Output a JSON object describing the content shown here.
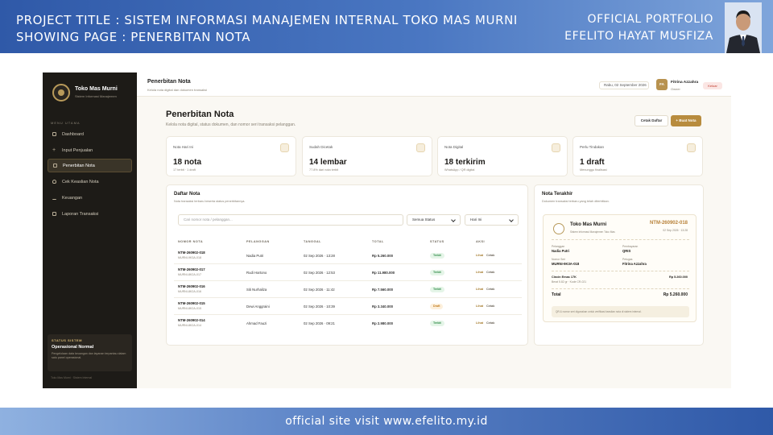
{
  "banner": {
    "line1": "PROJECT TITLE  : SISTEM INFORMASI MANAJEMEN INTERNAL TOKO MAS MURNI",
    "line2": "SHOWING PAGE : PENERBITAN NOTA",
    "right1": "OFFICIAL PORTFOLIO",
    "right2": "EFELITO HAYAT MUSFIZA",
    "footer": "official site visit www.efelito.my.id"
  },
  "sidebar": {
    "brand": "Toko Mas Murni",
    "brand_sub": "Sistem Informasi Manajemen",
    "menu_label": "MENU UTAMA",
    "items": [
      {
        "label": "Dashboard"
      },
      {
        "label": "Input Penjualan"
      },
      {
        "label": "Penerbitan Nota"
      },
      {
        "label": "Cek Keaslian Nota"
      },
      {
        "label": "Keuangan"
      },
      {
        "label": "Laporan Transaksi"
      }
    ],
    "status_heading": "STATUS SISTEM",
    "status_title": "Operasional Normal",
    "status_desc": "Pengelolaan data keuangan dan layanan terpantau dalam satu panel operasional.",
    "copyright": "Toko Mas Murni · Sistem Internal"
  },
  "topbar": {
    "title": "Penerbitan Nota",
    "subtitle": "Kelola nota digital dan dokumen transaksi",
    "date": "Rabu, 02 September 2026",
    "avatar": "FA",
    "user_name": "Fitrina Azzahra",
    "user_role": "Owner",
    "logout": "Keluar"
  },
  "page": {
    "title": "Penerbitan Nota",
    "subtitle": "Kelola nota digital, status dokumen, dan nomor seri transaksi pelanggan.",
    "btn_print": "Cetak Daftar",
    "btn_new": "+ Buat Nota"
  },
  "cards": [
    {
      "title": "Nota Hari Ini",
      "value": "18 nota",
      "desc": "17 terbit · 1 draft"
    },
    {
      "title": "Sudah Dicetak",
      "value": "14 lembar",
      "desc": "77.8% dari nota terbit"
    },
    {
      "title": "Nota Digital",
      "value": "18 terkirim",
      "desc": "WhatsApp / QR digital"
    },
    {
      "title": "Perlu Tindakan",
      "value": "1 draft",
      "desc": "Menunggu finalisasi"
    }
  ],
  "list": {
    "title": "Daftar Nota",
    "subtitle": "Nota transaksi terbaru beserta status penerbitannya.",
    "search_placeholder": "Cari nomor nota / pelanggan...",
    "filter_status": "Semua Status",
    "filter_day": "Hari Ini",
    "headers": [
      "NOMOR NOTA",
      "PELANGGAN",
      "TANGGAL",
      "TOTAL",
      "STATUS",
      "AKSI"
    ],
    "rows": [
      {
        "no": "NTM-260902-018",
        "serial": "MURNI-9K3A-018",
        "customer": "Nadia Putri",
        "date": "02 Sep 2026 · 13:28",
        "total": "Rp 5.260.000",
        "status": "Terbit",
        "view": "Lihat",
        "print": "Cetak"
      },
      {
        "no": "NTM-260902-017",
        "serial": "MURNI-8K2A-017",
        "customer": "Rudi Hartono",
        "date": "02 Sep 2026 · 12:53",
        "total": "Rp 11.980.000",
        "status": "Terbit",
        "view": "Lihat",
        "print": "Cetak"
      },
      {
        "no": "NTM-260902-016",
        "serial": "MURNI-8K2A-016",
        "customer": "Siti Nurhaliza",
        "date": "02 Sep 2026 · 11:42",
        "total": "Rp 7.560.000",
        "status": "Terbit",
        "view": "Lihat",
        "print": "Cetak"
      },
      {
        "no": "NTM-260902-015",
        "serial": "MURNI-8K2A-015",
        "customer": "Dewi Anggraini",
        "date": "02 Sep 2026 · 10:39",
        "total": "Rp 3.340.000",
        "status": "Draft",
        "view": "Lihat",
        "print": "Cetak"
      },
      {
        "no": "NTM-260902-014",
        "serial": "MURNI-8K2A-014",
        "customer": "Ahmad Fauzi",
        "date": "02 Sep 2026 · 09:21",
        "total": "Rp 2.980.000",
        "status": "Terbit",
        "view": "Lihat",
        "print": "Cetak"
      }
    ]
  },
  "latest": {
    "title": "Nota Terakhir",
    "subtitle": "Dokumen transaksi terbaru yang telah diterbitkan.",
    "shop": "Toko Mas Murni",
    "shop_sub": "Sistem Informasi Manajemen Toko Mas",
    "no": "NTM-260902-018",
    "date": "02 Sep 2026 · 13:28",
    "lbl_customer": "Pelanggan",
    "customer": "Nadia Putri",
    "lbl_payment": "Pembayaran",
    "payment": "QRIS",
    "lbl_serial": "Nomor Seri",
    "serial": "MURNI-9K3A-018",
    "lbl_staff": "Petugas",
    "staff": "Fitrina Azzahra",
    "item_name": "Cincin Emas 17K",
    "item_desc": "Berat 5.82 gr · Kode CR-021",
    "item_price": "Rp 5.260.000",
    "total_label": "Total",
    "total": "Rp 5.260.000",
    "note": "QR & nomor seri digunakan untuk verifikasi keaslian nota di sistem internal."
  }
}
